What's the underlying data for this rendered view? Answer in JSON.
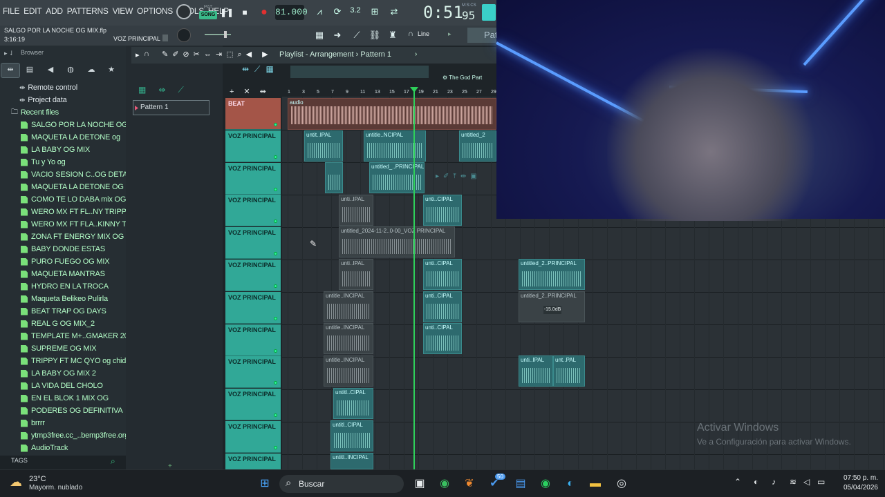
{
  "menu": [
    "FILE",
    "EDIT",
    "ADD",
    "PATTERNS",
    "VIEW",
    "OPTIONS",
    "TOOLS",
    "HELP"
  ],
  "transport": {
    "pat_label": "PAT",
    "song_label": "SONG",
    "tempo": "81.000",
    "time": "0:51",
    "time_frac": "95",
    "time_unit": "M:S:CS",
    "time_sig": "3.2"
  },
  "project": {
    "title": "SALGO POR LA NOCHE OG MIX.flp",
    "length": "3:16:19",
    "channel": "VOZ PRINCIPAL",
    "snap": "Line",
    "pattern_button": "Pat"
  },
  "browser": {
    "title": "Browser",
    "items": [
      {
        "label": "Remote control",
        "kind": "node"
      },
      {
        "label": "Project data",
        "kind": "node"
      },
      {
        "label": "Recent files",
        "kind": "folder"
      },
      {
        "label": "SALGO POR LA NOCHE OG MIX",
        "kind": "file"
      },
      {
        "label": "MAQUETA LA DETONE og",
        "kind": "file"
      },
      {
        "label": "LA BABY OG MIX",
        "kind": "file"
      },
      {
        "label": "Tu y Yo og",
        "kind": "file"
      },
      {
        "label": "VACIO SESION C..OG DETALLES",
        "kind": "file"
      },
      {
        "label": "MAQUETA LA DETONE OG REAL",
        "kind": "file"
      },
      {
        "label": "COMO TE LO DABA mix OG",
        "kind": "file"
      },
      {
        "label": "WERO MX FT FL..NY TRIPPY MIX",
        "kind": "file"
      },
      {
        "label": "WERO MX FT FLA..KINNY TRIPPY",
        "kind": "file"
      },
      {
        "label": "ZONA FT ENERGY MIX OG",
        "kind": "file"
      },
      {
        "label": "BABY DONDE ESTAS",
        "kind": "file"
      },
      {
        "label": "PURO FUEGO OG MIX",
        "kind": "file"
      },
      {
        "label": "MAQUETA MANTRAS",
        "kind": "file"
      },
      {
        "label": "HYDRO EN LA TROCA",
        "kind": "file"
      },
      {
        "label": "Maqueta Belikeo Pulirla",
        "kind": "file"
      },
      {
        "label": "BEAT TRAP OG DAYS",
        "kind": "file"
      },
      {
        "label": "REAL G OG MIX_2",
        "kind": "file"
      },
      {
        "label": "TEMPLATE M+..GMAKER 2024)",
        "kind": "file"
      },
      {
        "label": "SUPREME OG MIX",
        "kind": "file"
      },
      {
        "label": "TRIPPY FT MC QYO og chida",
        "kind": "file"
      },
      {
        "label": "LA BABY OG MIX 2",
        "kind": "file"
      },
      {
        "label": "LA VIDA DEL CHOLO",
        "kind": "file"
      },
      {
        "label": "EN EL BLOK 1 MIX OG",
        "kind": "file"
      },
      {
        "label": "PODERES OG DEFINITIVA",
        "kind": "file"
      },
      {
        "label": "brrrr",
        "kind": "file"
      },
      {
        "label": "ytmp3free.cc_..bemp3free.org",
        "kind": "file"
      },
      {
        "label": "AudioTrack",
        "kind": "file"
      }
    ],
    "tags_label": "TAGS"
  },
  "playlist": {
    "title": "Playlist - Arrangement",
    "separator": "›",
    "pattern": "Pattern 1",
    "pattern_item": "Pattern 1",
    "audio_label": "audio",
    "now_playing": "The God Part",
    "ruler": [
      "1",
      "3",
      "5",
      "7",
      "9",
      "11",
      "13",
      "15",
      "17",
      "19",
      "21",
      "23",
      "25",
      "27",
      "29"
    ],
    "tracks": [
      "BEAT",
      "VOZ PRINCIPAL",
      "VOZ PRINCIPAL",
      "VOZ PRINCIPAL",
      "VOZ PRINCIPAL",
      "VOZ PRINCIPAL",
      "VOZ PRINCIPAL",
      "VOZ PRINCIPAL",
      "VOZ PRINCIPAL",
      "VOZ PRINCIPAL",
      "VOZ PRINCIPAL",
      "VOZ PRINCIPAL"
    ],
    "clip_labels": {
      "c1": "untit..IPAL",
      "c2": "untitle..NCIPAL",
      "c3": "untitled_2",
      "c4": "untitled_..PRINCIPAL",
      "c5": "unti..IPAL",
      "c6": "unti..CIPAL",
      "c7": "untitled_2024-11-2..0-00_VOZ PRINCIPAL",
      "c8": "unti..IPAL",
      "c9": "unti..CIPAL",
      "c10": "untitled_2..PRINCIPAL",
      "c11": "untitle..INCIPAL",
      "c12": "unti..CIPAL",
      "c13": "untitled_2..PRINCIPAL",
      "c14": "untitle..INCIPAL",
      "c15": "unti..CIPAL",
      "c16": "untitle..INCIPAL",
      "c17": "unti..IPAL",
      "c18": "unt..PAL",
      "c19": "untitl..CIPAL",
      "c20": "untitl..CIPAL",
      "c21": "untitl..INCIPAL"
    },
    "volume_badge": "-15.0dB"
  },
  "watermark": {
    "line1": "Activar Windows",
    "line2": "Ve a Configuración para activar Windows."
  },
  "taskbar": {
    "temp": "23°C",
    "condition": "Mayorm. nublado",
    "search": "Buscar",
    "badge": "50",
    "time": "07:50 p. m.",
    "date": "05/04/2026"
  },
  "colors": {
    "accent": "#3aba8a",
    "track": "#31a897",
    "beat": "#a45548",
    "neon": "#5a9cff"
  }
}
